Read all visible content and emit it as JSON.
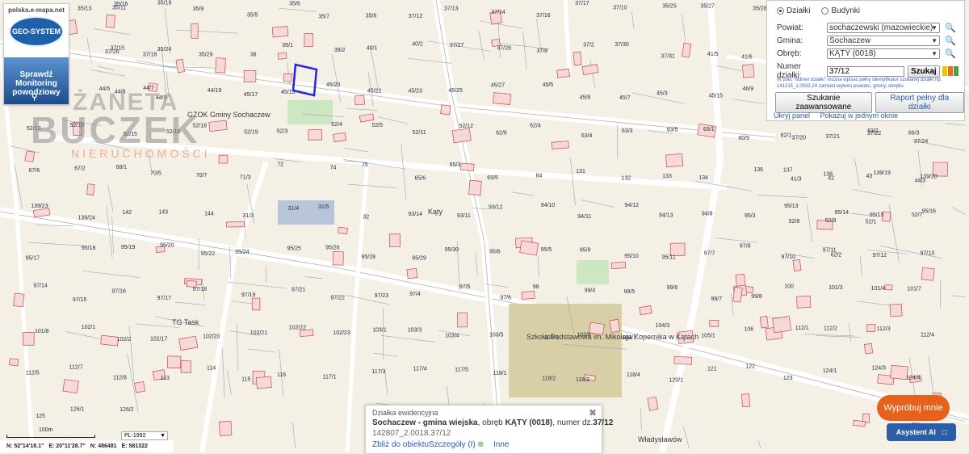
{
  "logo": {
    "site": "polska.e-mapa.net",
    "brand": "GEO-SYSTEM",
    "monitoring": [
      "Sprawdź",
      "Monitoring",
      "powodziowy"
    ]
  },
  "watermark": {
    "line1": "ŻANETA",
    "line2": "BUCZEK",
    "line3": "NIERUCHOMOŚCI"
  },
  "search_panel": {
    "modes": [
      "Działki",
      "Budynki"
    ],
    "selected_mode": "Działki",
    "powiat_label": "Powiat:",
    "powiat_value": "sochaczewski (mazowieckie)",
    "gmina_label": "Gmina:",
    "gmina_value": "Sochaczew",
    "obreb_label": "Obręb:",
    "obreb_value": "KĄTY (0018)",
    "numer_label": "Numer działki:",
    "numer_value": "37/12",
    "search_button": "Szukaj",
    "hint": "W polu \"Numer działki\" można wpisać pełny identyfikator szukanej działki np. 141215_1.0032.24 zamiast wyboru powiatu, gminy, obrębu",
    "advanced_button": "Szukanie zaawansowane",
    "report_button": "Raport pełny dla działki",
    "hide_panel": "Ukryj panel",
    "show_in_one_window": "Pokażuj w jednym oknie",
    "colors": [
      "#f2c200",
      "#e07020",
      "#4aa040"
    ]
  },
  "popup": {
    "header": "Działka ewidencyjna",
    "prefix": "Sochaczew - gmina wiejska",
    "obreb_text": ", obręb ",
    "obreb": "KĄTY (0018)",
    "numer_text": ", numer dz.",
    "numer": "37/12",
    "identifier": "142807_2.0018.37/12",
    "zoom_link": "Zbliż do obiektu",
    "details_link": "Szczegóły (I)",
    "more_link": "Inne"
  },
  "scale": {
    "label": "100m"
  },
  "crs": {
    "value": "PL-1992"
  },
  "coords": {
    "n": "N: 52°14'18.1\"",
    "e": "E: 20°11'28.7\"",
    "x": "N: 486481",
    "y": "E: 581322"
  },
  "buttons": {
    "try_ai": "Wypróbuj mnie",
    "assistant": "Asystent AI"
  },
  "places": {
    "gzok": "GZOK Gminy Sochaczew",
    "katy": "Kąty",
    "tg": "TG Task",
    "school": "Szkoła Podstawowa im. Mikołaja Kopernika w Kątach",
    "street": "Władysławów"
  },
  "plots": [
    "35/11",
    "35/13",
    "35/16",
    "35/19",
    "35/9",
    "35/5",
    "35/6",
    "35/7",
    "35/8",
    "37/12",
    "37/13",
    "37/14",
    "37/16",
    "37/17",
    "37/10",
    "35/25",
    "35/27",
    "35/28",
    "37/20",
    "37/21",
    "37/22",
    "37/24",
    "37/26",
    "37/18",
    "37/15",
    "35/24",
    "35/29",
    "38",
    "39/1",
    "39/2",
    "40/1",
    "40/2",
    "37/27",
    "37/28",
    "37/8",
    "37/2",
    "37/30",
    "37/31",
    "41/5",
    "41/6",
    "41/3",
    "42",
    "43",
    "44/3",
    "44/5",
    "44/7",
    "44/8",
    "44/9",
    "44/19",
    "45/17",
    "45/13",
    "45/20",
    "45/22",
    "45/23",
    "45/25",
    "45/27",
    "45/5",
    "45/8",
    "45/7",
    "45/3",
    "45/15",
    "46/9",
    "52/8",
    "52/9",
    "52/1",
    "52/7",
    "52/10",
    "52/13",
    "52/15",
    "52/16",
    "52/18",
    "52/19",
    "52/3",
    "52/4",
    "52/5",
    "52/11",
    "52/12",
    "62/6",
    "62/4",
    "63/4",
    "63/3",
    "63/5",
    "63/1",
    "60/9",
    "62/1",
    "62/2",
    "63/2",
    "66/3",
    "67/6",
    "67/2",
    "68/1",
    "70/5",
    "70/7",
    "71/3",
    "72",
    "74",
    "75",
    "65/6",
    "65/3",
    "65/5",
    "64",
    "131",
    "132",
    "133",
    "134",
    "136",
    "137",
    "138",
    "139/19",
    "139/20",
    "139/23",
    "139/24",
    "142",
    "143",
    "144",
    "31/3",
    "31/4",
    "31/5",
    "32",
    "93/14",
    "93/11",
    "93/12",
    "94/10",
    "94/11",
    "94/12",
    "94/13",
    "94/9",
    "95/3",
    "95/13",
    "95/14",
    "95/15",
    "95/16",
    "95/17",
    "95/18",
    "95/19",
    "95/20",
    "95/22",
    "95/24",
    "95/25",
    "95/26",
    "95/28",
    "95/29",
    "95/30",
    "95/6",
    "95/5",
    "95/9",
    "95/10",
    "95/11",
    "97/7",
    "97/8",
    "97/10",
    "97/11",
    "97/12",
    "97/13",
    "97/14",
    "97/15",
    "97/16",
    "97/17",
    "97/18",
    "97/19",
    "97/21",
    "97/22",
    "97/23",
    "97/4",
    "97/5",
    "97/6",
    "98",
    "99/4",
    "99/5",
    "99/6",
    "99/7",
    "99/8",
    "100",
    "101/3",
    "101/4",
    "101/7",
    "101/8",
    "102/1",
    "102/2",
    "102/17",
    "102/20",
    "102/21",
    "102/22",
    "102/23",
    "103/1",
    "103/3",
    "103/4",
    "103/5",
    "103/6",
    "103/8",
    "104/1",
    "104/3",
    "105/1",
    "106",
    "112/1",
    "112/2",
    "112/3",
    "112/4",
    "112/5",
    "112/7",
    "112/8",
    "113",
    "114",
    "115",
    "116",
    "117/1",
    "117/3",
    "117/4",
    "117/5",
    "118/1",
    "118/2",
    "118/3",
    "118/4",
    "120/1",
    "121",
    "122",
    "123",
    "124/1",
    "124/3",
    "124/4",
    "125",
    "126/1",
    "126/2"
  ]
}
